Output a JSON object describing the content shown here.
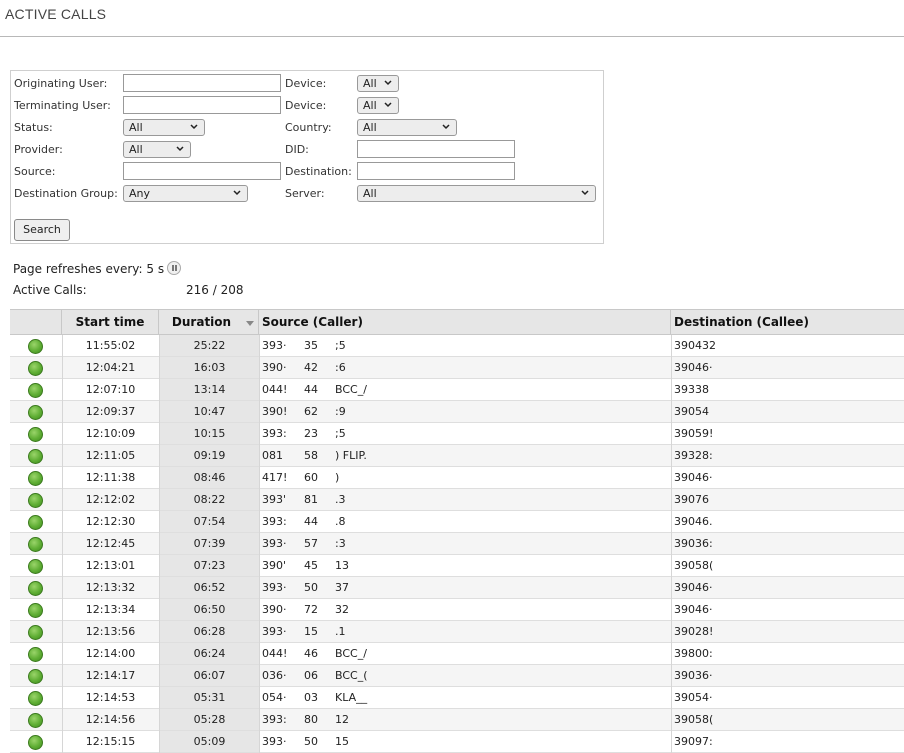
{
  "page": {
    "title": "ACTIVE CALLS"
  },
  "filters": {
    "originating_user_label": "Originating User:",
    "terminating_user_label": "Terminating User:",
    "device_label": "Device:",
    "device1_value": "All",
    "device2_value": "All",
    "status_label": "Status:",
    "status_value": "All",
    "country_label": "Country:",
    "country_value": "All",
    "provider_label": "Provider:",
    "provider_value": "All",
    "did_label": "DID:",
    "source_label": "Source:",
    "destination_label": "Destination:",
    "destination_group_label": "Destination Group:",
    "destination_group_value": "Any",
    "server_label": "Server:",
    "server_value": "All",
    "search_label": "Search"
  },
  "info": {
    "refresh_text": "Page refreshes every: 5 s",
    "active_calls_label": "Active Calls:",
    "active_calls_value": "216 / 208"
  },
  "table": {
    "headers": {
      "start_time": "Start time",
      "duration": "Duration",
      "source": "Source (Caller)",
      "destination": "Destination (Callee)"
    },
    "rows": [
      {
        "start": "11:55:02",
        "duration": "25:22",
        "src1": "393·",
        "src2": "35",
        "src3": ";5",
        "dest": "390432"
      },
      {
        "start": "12:04:21",
        "duration": "16:03",
        "src1": "390·",
        "src2": "42",
        "src3": ":6",
        "dest": "39046·"
      },
      {
        "start": "12:07:10",
        "duration": "13:14",
        "src1": "044!",
        "src2": "44",
        "src3": "BCC_/",
        "dest": "39338"
      },
      {
        "start": "12:09:37",
        "duration": "10:47",
        "src1": "390!",
        "src2": "62",
        "src3": ":9",
        "dest": "39054"
      },
      {
        "start": "12:10:09",
        "duration": "10:15",
        "src1": "393:",
        "src2": "23",
        "src3": ";5",
        "dest": "39059!"
      },
      {
        "start": "12:11:05",
        "duration": "09:19",
        "src1": "081",
        "src2": "58",
        "src3": ") FLIP.",
        "dest": "39328:"
      },
      {
        "start": "12:11:38",
        "duration": "08:46",
        "src1": "417!",
        "src2": "60",
        "src3": ")",
        "dest": "39046·"
      },
      {
        "start": "12:12:02",
        "duration": "08:22",
        "src1": "393'",
        "src2": "81",
        "src3": ".3",
        "dest": "39076"
      },
      {
        "start": "12:12:30",
        "duration": "07:54",
        "src1": "393:",
        "src2": "44",
        "src3": ".8",
        "dest": "39046."
      },
      {
        "start": "12:12:45",
        "duration": "07:39",
        "src1": "393·",
        "src2": "57",
        "src3": ":3",
        "dest": "39036:"
      },
      {
        "start": "12:13:01",
        "duration": "07:23",
        "src1": "390'",
        "src2": "45",
        "src3": "13",
        "dest": "39058("
      },
      {
        "start": "12:13:32",
        "duration": "06:52",
        "src1": "393·",
        "src2": "50",
        "src3": "37",
        "dest": "39046·"
      },
      {
        "start": "12:13:34",
        "duration": "06:50",
        "src1": "390·",
        "src2": "72",
        "src3": "32",
        "dest": "39046·"
      },
      {
        "start": "12:13:56",
        "duration": "06:28",
        "src1": "393·",
        "src2": "15",
        "src3": ".1",
        "dest": "39028!"
      },
      {
        "start": "12:14:00",
        "duration": "06:24",
        "src1": "044!",
        "src2": "46",
        "src3": "BCC_/",
        "dest": "39800:"
      },
      {
        "start": "12:14:17",
        "duration": "06:07",
        "src1": "036·",
        "src2": "06",
        "src3": "BCC_(",
        "dest": "39036·"
      },
      {
        "start": "12:14:53",
        "duration": "05:31",
        "src1": "054·",
        "src2": "03",
        "src3": "KLA__",
        "dest": "39054·"
      },
      {
        "start": "12:14:56",
        "duration": "05:28",
        "src1": "393:",
        "src2": "80",
        "src3": "12",
        "dest": "39058("
      },
      {
        "start": "12:15:15",
        "duration": "05:09",
        "src1": "393·",
        "src2": "50",
        "src3": "15",
        "dest": "39097:"
      }
    ]
  },
  "colors": {
    "status_active": "#5fae34",
    "header_bg": "#e6e6e6"
  }
}
